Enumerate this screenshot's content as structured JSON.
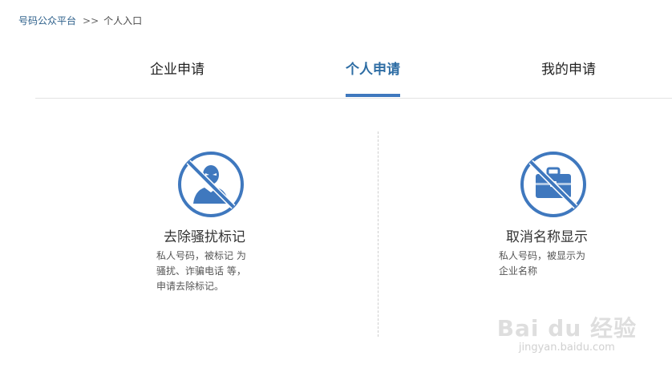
{
  "breadcrumb": {
    "root": "号码公众平台",
    "separator": ">>",
    "current": "个人入口"
  },
  "tabs": [
    {
      "label": "企业申请",
      "active": false
    },
    {
      "label": "个人申请",
      "active": true
    },
    {
      "label": "我的申请",
      "active": false
    }
  ],
  "cards": [
    {
      "icon": "no-harassment-icon",
      "title": "去除骚扰标记",
      "desc": [
        "私人号码，被标记 为",
        "骚扰、诈骗电话 等，",
        "申请去除标记。"
      ]
    },
    {
      "icon": "no-company-name-icon",
      "title": "取消名称显示",
      "desc": [
        "私人号码，被显示为",
        "企业名称"
      ]
    }
  ],
  "watermark": {
    "logo": "Bai du 经验",
    "url": "jingyan.baidu.com"
  },
  "colors": {
    "accent": "#3f78be",
    "icon": "#3f78be",
    "divider": "#cfcfcf"
  }
}
